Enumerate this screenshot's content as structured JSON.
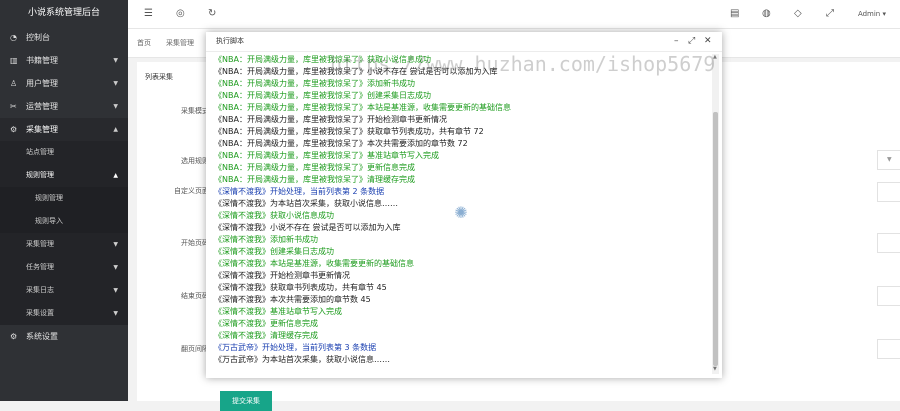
{
  "app": {
    "title": "小说系统管理后台"
  },
  "sidebar": {
    "items": [
      {
        "label": "控制台",
        "icon": "dashboard-icon"
      },
      {
        "label": "书籍管理",
        "icon": "book-icon"
      },
      {
        "label": "用户管理",
        "icon": "user-icon"
      },
      {
        "label": "运营管理",
        "icon": "operations-icon"
      },
      {
        "label": "采集管理",
        "icon": "gear-icon"
      }
    ],
    "sub_items": {
      "site": "站点管理",
      "rules": "规则管理",
      "rule_manage": "规则管理",
      "rule_import": "规则导入",
      "collect": "采集管理",
      "tasks": "任务管理",
      "logs": "采集日志",
      "settings": "采集设置",
      "more": "系统设置"
    }
  },
  "topbar": {
    "user": "Admin ▾"
  },
  "tabs": {
    "home": "首页",
    "current": "采集管理"
  },
  "content": {
    "tab": "列表采集",
    "labels": {
      "mode": "采集模式",
      "rule": "选用规则",
      "custom": "自定义页面",
      "start": "开始页码",
      "end": "结束页码",
      "interval": "翻页间隔"
    },
    "submit": "提交采集"
  },
  "modal": {
    "title": "执行脚本",
    "lines": [
      {
        "text": "《NBA：开局满级力量，库里被我惊呆了》获取小说信息成功",
        "color": "green"
      },
      {
        "text": "《NBA：开局满级力量，库里被我惊呆了》小说不存在 尝试是否可以添加为入库",
        "color": "dark"
      },
      {
        "text": "《NBA：开局满级力量，库里被我惊呆了》添加新书成功",
        "color": "green"
      },
      {
        "text": "《NBA：开局满级力量，库里被我惊呆了》创建采集日志成功",
        "color": "green"
      },
      {
        "text": "《NBA：开局满级力量，库里被我惊呆了》本站是基准源，收集需要更新的基础信息",
        "color": "green"
      },
      {
        "text": "《NBA：开局满级力量，库里被我惊呆了》开始检测章书更新情况",
        "color": "dark"
      },
      {
        "text": "《NBA：开局满级力量，库里被我惊呆了》获取章节列表成功，共有章节 72",
        "color": "dark"
      },
      {
        "text": "《NBA：开局满级力量，库里被我惊呆了》本次共需要添加的章节数 72",
        "color": "dark"
      },
      {
        "text": "《NBA：开局满级力量，库里被我惊呆了》基准站章节写入完成",
        "color": "green"
      },
      {
        "text": "《NBA：开局满级力量，库里被我惊呆了》更新信息完成",
        "color": "green"
      },
      {
        "text": "《NBA：开局满级力量，库里被我惊呆了》清理缓存完成",
        "color": "green"
      },
      {
        "text": "《深情不渡我》开始处理，当前列表第 2 条数据",
        "color": "blue"
      },
      {
        "text": "《深情不渡我》为本站首次采集，获取小说信息……",
        "color": "dark"
      },
      {
        "text": "《深情不渡我》获取小说信息成功",
        "color": "green"
      },
      {
        "text": "《深情不渡我》小说不存在 尝试是否可以添加为入库",
        "color": "dark"
      },
      {
        "text": "《深情不渡我》添加新书成功",
        "color": "green"
      },
      {
        "text": "《深情不渡我》创建采集日志成功",
        "color": "green"
      },
      {
        "text": "《深情不渡我》本站是基准源，收集需要更新的基础信息",
        "color": "green"
      },
      {
        "text": "《深情不渡我》开始检测章书更新情况",
        "color": "dark"
      },
      {
        "text": "《深情不渡我》获取章书列表成功，共有章节 45",
        "color": "dark"
      },
      {
        "text": "《深情不渡我》本次共需要添加的章节数 45",
        "color": "dark"
      },
      {
        "text": "《深情不渡我》基准站章节写入完成",
        "color": "green"
      },
      {
        "text": "《深情不渡我》更新信息完成",
        "color": "green"
      },
      {
        "text": "《深情不渡我》清理缓存完成",
        "color": "green"
      },
      {
        "text": "《万古武帝》开始处理，当前列表第 3 条数据",
        "color": "blue"
      },
      {
        "text": "《万古武帝》为本站首次采集，获取小说信息……",
        "color": "dark"
      }
    ]
  },
  "watermark": "https://www.huzhan.com/ishop5679"
}
